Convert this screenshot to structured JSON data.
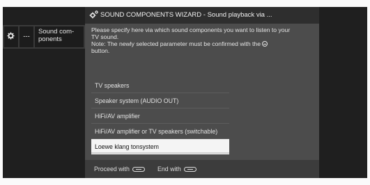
{
  "menu": {
    "dots": "---",
    "sound_line1": "Sound com-",
    "sound_line2": "ponents"
  },
  "wizard": {
    "title": "SOUND COMPONENTS WIZARD - Sound playback via ...",
    "instructions": {
      "line1": "Please specify here via which sound components you want to listen to your",
      "line2": "TV sound.",
      "line3": "Note: The newly selected parameter must be confirmed with the",
      "line4": "button."
    },
    "options": [
      "TV speakers",
      "Speaker system (AUDIO OUT)",
      "HiFi/AV amplifier",
      "HiFi/AV amplifier or TV speakers (switchable)",
      "Loewe klang tonsystem"
    ],
    "selected_index": 4,
    "footer": {
      "proceed_label": "Proceed with",
      "end_label": "End with"
    }
  },
  "icons": {
    "menu_icon": "gear-icon",
    "wizard_icon": "wizard-gears-icon",
    "confirm_icon": "ok-button-icon",
    "proceed_icon": "forward-key-icon",
    "end_icon": "end-key-icon"
  },
  "colors": {
    "selected_bg": "#f4f4f4",
    "panel_bg": "#4c4c4c",
    "screen_bg": "#1f1f1f"
  }
}
